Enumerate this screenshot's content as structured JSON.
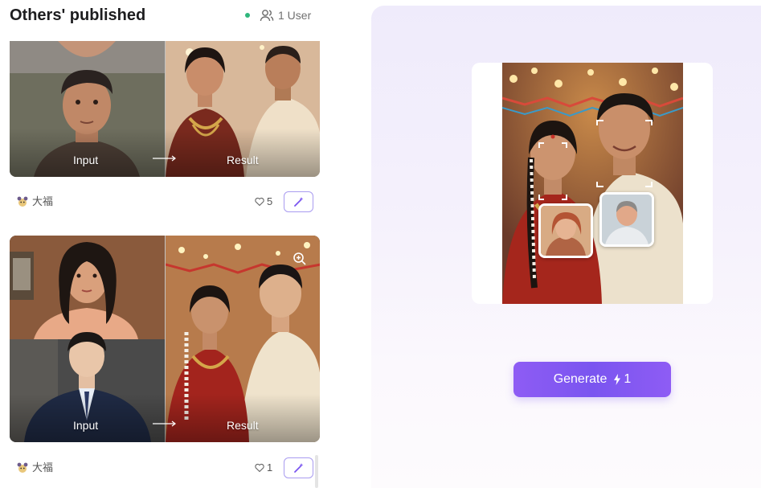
{
  "header": {
    "title": "Others' published",
    "online_users": "1 User"
  },
  "feed": [
    {
      "input_label": "Input",
      "result_label": "Result",
      "author": "大福",
      "likes": "5"
    },
    {
      "input_label": "Input",
      "result_label": "Result",
      "author": "大福",
      "likes": "1"
    }
  ],
  "editor": {
    "generate_label": "Generate",
    "credit_cost": "1"
  },
  "colors": {
    "accent": "#7a55f0",
    "online": "#2fb67c"
  }
}
